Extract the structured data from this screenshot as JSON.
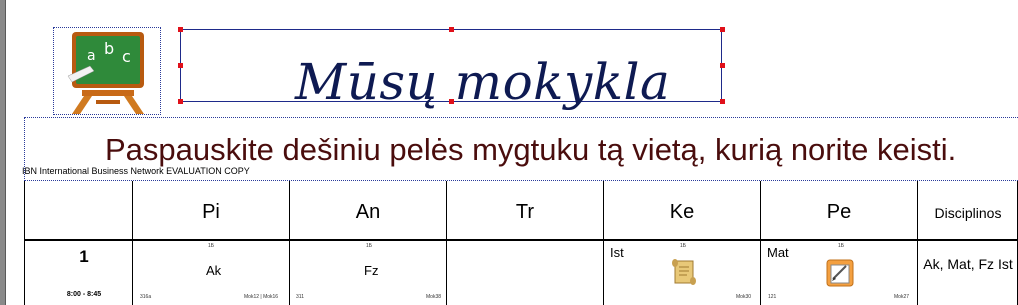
{
  "header": {
    "school_title": "Mūsų mokykla",
    "instructions": "Paspauskite dešiniu pelės mygtuku tą vietą, kurią norite keisti.",
    "watermark": "IBN International Business Network EVALUATION COPY",
    "logo_letters": [
      "a",
      "b",
      "c"
    ]
  },
  "timetable": {
    "days": [
      "Pi",
      "An",
      "Tr",
      "Ke",
      "Pe"
    ],
    "disciplines_header": "Disciplinos",
    "lessons": [
      {
        "number": "1",
        "time": "8:00 - 8:45",
        "cells": [
          {
            "top": "1Б",
            "subject": "Ak",
            "room": "316a",
            "teacher": "Mok12 | Mok16"
          },
          {
            "top": "1Б",
            "subject": "Fz",
            "room": "311",
            "teacher": "Mok38"
          },
          {
            "top": "",
            "subject": "",
            "room": "",
            "teacher": ""
          },
          {
            "top": "1Б",
            "subject": "Ist",
            "room": "",
            "teacher": "Mok30",
            "icon": "scroll-icon"
          },
          {
            "top": "1Б",
            "subject": "Mat",
            "room": "121",
            "teacher": "Mok27",
            "icon": "edit-icon"
          }
        ],
        "disciplines": "Ak, Mat, Fz Ist"
      }
    ]
  },
  "colors": {
    "title": "#0e1a52",
    "instructions": "#4a0d0d",
    "selection_handles": "#e0101a",
    "frame_border": "#1e2a8a"
  }
}
